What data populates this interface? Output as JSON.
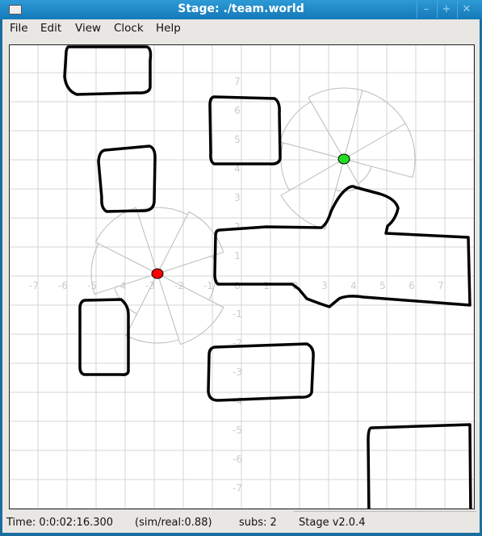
{
  "window": {
    "title": "Stage: ./team.world"
  },
  "menu": [
    "File",
    "Edit",
    "View",
    "Clock",
    "Help"
  ],
  "axes": {
    "x_ticks": [
      "-7",
      "-6",
      "-5",
      "-4",
      "-3",
      "-2",
      "-1",
      "0",
      "1",
      "2",
      "3",
      "4",
      "5",
      "6",
      "7"
    ],
    "y_ticks": [
      "7",
      "6",
      "5",
      "4",
      "3",
      "2",
      "1",
      "-1",
      "-2",
      "-3",
      "-4",
      "-5",
      "-6",
      "-7"
    ]
  },
  "robots": [
    {
      "color": "#ff0000"
    },
    {
      "color": "#22dd22"
    }
  ],
  "status": {
    "time": "Time: 0:0:02:16.300",
    "ratio": "(sim/real:0.88)",
    "subs": "subs: 2",
    "version": "Stage v2.0.4"
  }
}
